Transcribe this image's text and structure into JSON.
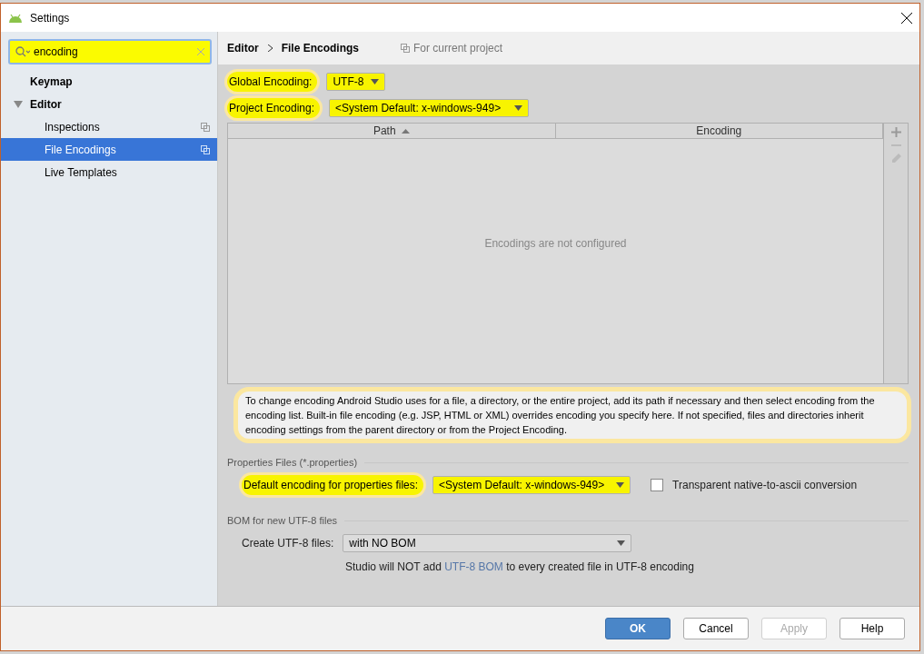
{
  "window": {
    "title": "Settings"
  },
  "search": {
    "value": "encoding",
    "highlighted": true
  },
  "sidebar": {
    "items": [
      {
        "label": "Keymap",
        "kind": "group",
        "selected": false
      },
      {
        "label": "Editor",
        "kind": "folder",
        "selected": false,
        "expanded": true,
        "children": [
          {
            "label": "Inspections",
            "kind": "page",
            "selected": false
          },
          {
            "label": "File Encodings",
            "kind": "page",
            "selected": true
          },
          {
            "label": "Live Templates",
            "kind": "leaf",
            "selected": false
          }
        ]
      }
    ]
  },
  "breadcrumb": [
    "Editor",
    "File Encodings"
  ],
  "scope_note": "For current project",
  "global_encoding": {
    "label": "Global Encoding:",
    "value": "UTF-8",
    "highlighted": true
  },
  "project_encoding": {
    "label": "Project Encoding:",
    "value": "<System Default: x-windows-949>",
    "highlighted": true
  },
  "table": {
    "columns": [
      {
        "label": "Path",
        "sorted": true
      },
      {
        "label": "Encoding",
        "sorted": false
      }
    ],
    "empty_text": "Encodings are not configured"
  },
  "info": {
    "text": "To change encoding Android Studio uses for a file, a directory, or the entire project, add its path if necessary and then select encoding from the encoding list. Built-in file encoding (e.g. JSP, HTML or XML) overrides encoding you specify here. If not specified, files and directories inherit encoding settings from the parent directory or from the Project Encoding.",
    "highlighted": true
  },
  "properties": {
    "title": "Properties Files (*.properties)",
    "label": "Default encoding for properties files:",
    "value": "<System Default: x-windows-949>",
    "highlighted": true,
    "checkbox": {
      "label": "Transparent native-to-ascii conversion",
      "checked": false
    }
  },
  "bom": {
    "title": "BOM for new UTF-8 files",
    "label": "Create UTF-8 files:",
    "value": "with NO BOM",
    "note_before": "Studio will NOT add",
    "note_link": "UTF-8 BOM",
    "note_after": "to every created file in UTF-8 encoding"
  },
  "buttons": [
    {
      "label": "OK",
      "kind": "primary",
      "disabled": false
    },
    {
      "label": "Cancel",
      "kind": "normal",
      "disabled": false
    },
    {
      "label": "Apply",
      "kind": "normal",
      "disabled": true
    },
    {
      "label": "Help",
      "kind": "normal",
      "disabled": false
    }
  ]
}
